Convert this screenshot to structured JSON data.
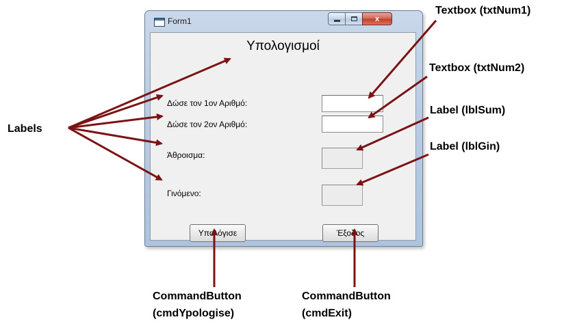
{
  "window": {
    "title": "Form1",
    "close_glyph": "x",
    "heading": "Υπολογισμοί",
    "labels": {
      "num1": "Δώσε τον 1ον Αριθμό:",
      "num2": "Δώσε τον 2ον Αριθμό:",
      "sum": "Άθροισμα:",
      "product": "Γινόμενο:"
    },
    "txtNum1_value": "",
    "txtNum2_value": "",
    "buttons": {
      "calculate": "Υπολόγισε",
      "exit": "Έξοδος"
    }
  },
  "annotations": {
    "labels": "Labels",
    "txtNum1": "Textbox (txtNum1)",
    "txtNum2": "Textbox (txtNum2)",
    "lblSum": "Label (lblSum)",
    "lblGin": "Label (lblGin)",
    "cmdYpologise_line1": "CommandButton",
    "cmdYpologise_line2": "(cmdYpologise)",
    "cmdExit_line1": "CommandButton",
    "cmdExit_line2": "(cmdExit)"
  },
  "colors": {
    "arrow": "#7b1214",
    "window_frame": "#b9cce3",
    "close_button": "#c0432f"
  },
  "icons": [
    "form-icon",
    "minimize-icon",
    "maximize-icon",
    "close-icon"
  ]
}
